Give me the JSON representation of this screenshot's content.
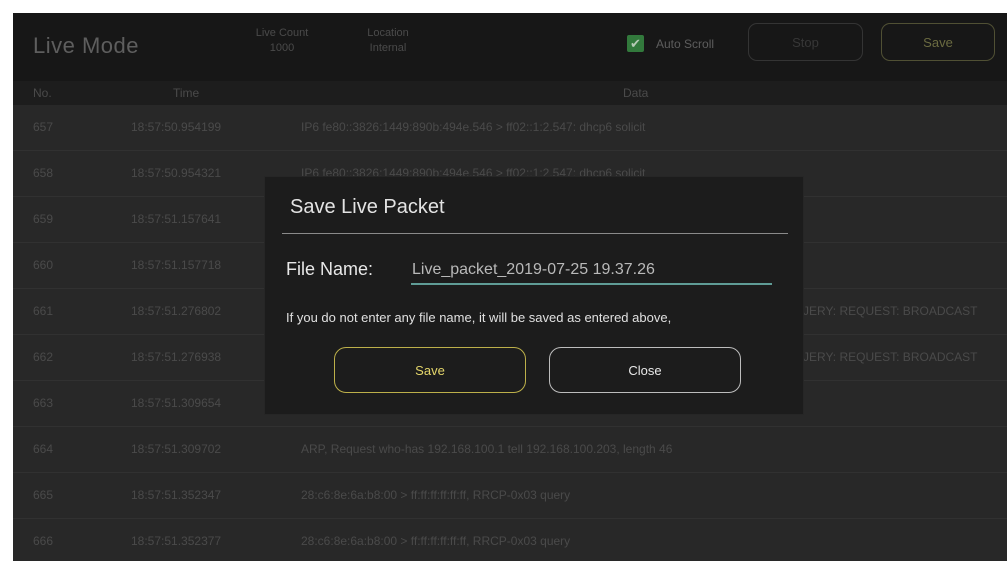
{
  "header": {
    "title": "Live Mode",
    "live_count_label": "Live Count",
    "live_count_value": "1000",
    "location_label": "Location",
    "location_value": "Internal",
    "auto_scroll_label": "Auto Scroll",
    "auto_scroll_checked": true,
    "stop_label": "Stop",
    "save_label": "Save"
  },
  "columns": {
    "no": "No.",
    "time": "Time",
    "data": "Data"
  },
  "rows": [
    {
      "no": "657",
      "time": "18:57:50.954199",
      "data": "IP6 fe80::3826:1449:890b:494e.546 > ff02::1:2.547: dhcp6 solicit"
    },
    {
      "no": "658",
      "time": "18:57:50.954321",
      "data": "IP6 fe80::3826:1449:890b:494e.546 > ff02::1:2.547: dhcp6 solicit"
    },
    {
      "no": "659",
      "time": "18:57:51.157641",
      "data": ""
    },
    {
      "no": "660",
      "time": "18:57:51.157718",
      "data": ""
    },
    {
      "no": "661",
      "time": "18:57:51.276802",
      "data": "JERY: REQUEST: BROADCAST"
    },
    {
      "no": "662",
      "time": "18:57:51.276938",
      "data": "JERY: REQUEST: BROADCAST"
    },
    {
      "no": "663",
      "time": "18:57:51.309654",
      "data": ""
    },
    {
      "no": "664",
      "time": "18:57:51.309702",
      "data": "ARP, Request who-has 192.168.100.1 tell 192.168.100.203, length 46"
    },
    {
      "no": "665",
      "time": "18:57:51.352347",
      "data": "28:c6:8e:6a:b8:00 > ff:ff:ff:ff:ff:ff, RRCP-0x03 query"
    },
    {
      "no": "666",
      "time": "18:57:51.352377",
      "data": "28:c6:8e:6a:b8:00 > ff:ff:ff:ff:ff:ff, RRCP-0x03 query"
    }
  ],
  "dialog": {
    "title": "Save Live Packet",
    "file_name_label": "File Name:",
    "file_name_value": "Live_packet_2019-07-25 19.37.26",
    "hint": "If you do not enter any file name, it will be saved as entered above,",
    "save_label": "Save",
    "close_label": "Close"
  },
  "colors": {
    "accent_green": "#3a8a45",
    "input_underline": "#5f9c96",
    "save_button_border": "#bdb04a"
  }
}
